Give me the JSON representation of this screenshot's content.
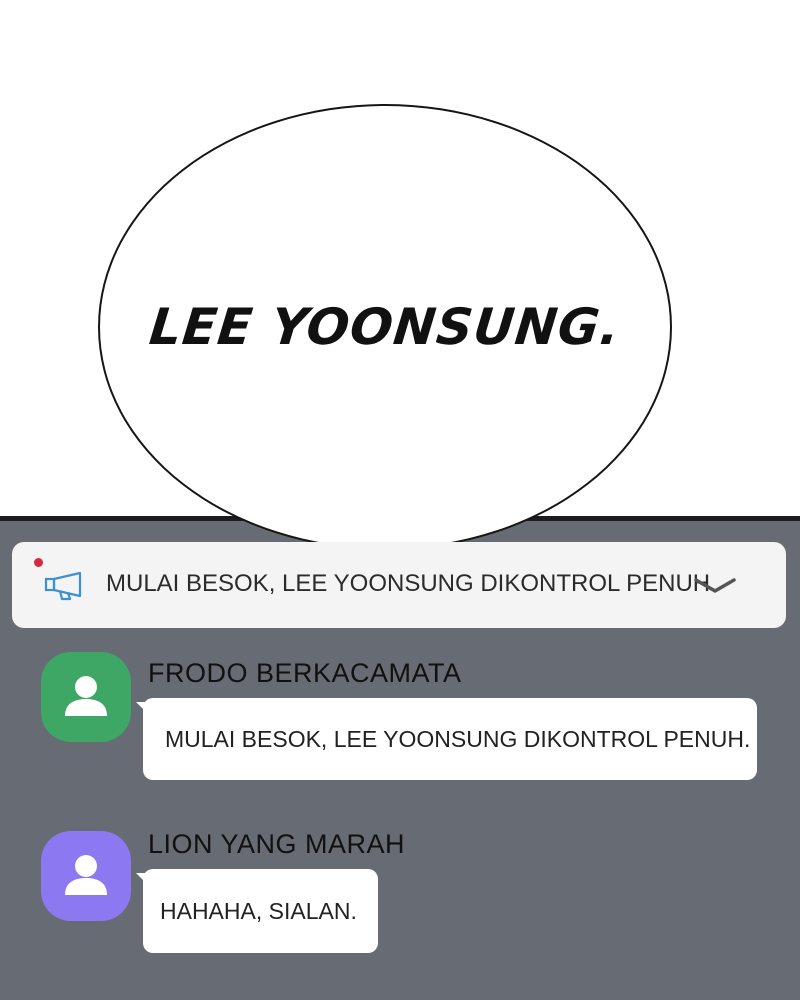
{
  "comic": {
    "speech_text": "LEE YOONSUNG."
  },
  "chat": {
    "background_color": "#676b74",
    "notice": {
      "text": "MULAI BESOK, LEE YOONSUNG DIKONTROL PENUH.",
      "icon": "megaphone-icon",
      "unread_dot_color": "#d32a3f",
      "expand_icon": "chevron-down-icon"
    },
    "messages": [
      {
        "sender": "FRODO BERKACAMATA",
        "text": "MULAI BESOK, LEE YOONSUNG DIKONTROL PENUH.",
        "avatar_color": "#3ea766",
        "avatar_icon": "person-icon"
      },
      {
        "sender": "LION YANG MARAH",
        "text": "HAHAHA, SIALAN.",
        "avatar_color": "#8c79f2",
        "avatar_icon": "person-icon"
      }
    ]
  }
}
